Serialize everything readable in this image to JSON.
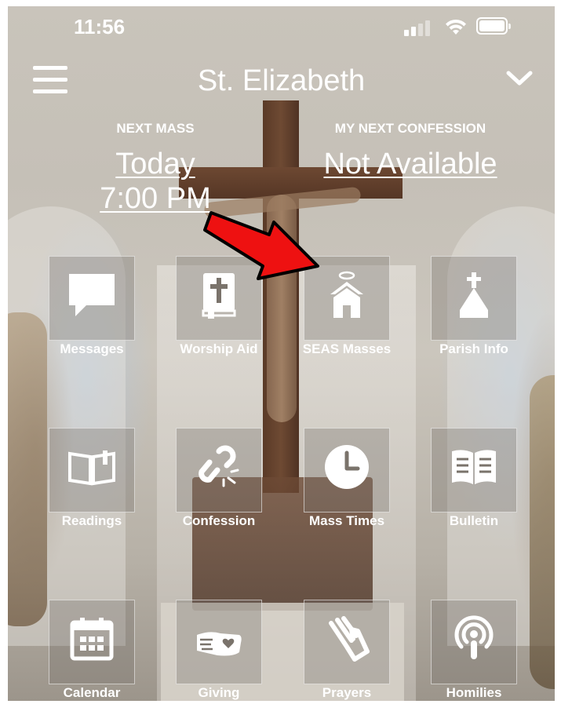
{
  "status_bar": {
    "time": "11:56"
  },
  "header": {
    "title": "St. Elizabeth"
  },
  "next_mass": {
    "label": "NEXT MASS",
    "day": "Today",
    "time": "7:00 PM"
  },
  "next_confession": {
    "label": "MY NEXT CONFESSION",
    "value": "Not Available"
  },
  "tiles": [
    {
      "label": "Messages",
      "icon": "message-icon"
    },
    {
      "label": "Worship Aid",
      "icon": "bible-icon"
    },
    {
      "label": "SEAS Masses",
      "icon": "church-icon"
    },
    {
      "label": "Parish Info",
      "icon": "steeple-icon"
    },
    {
      "label": "Readings",
      "icon": "open-book-icon"
    },
    {
      "label": "Confession",
      "icon": "broken-link-icon"
    },
    {
      "label": "Mass Times",
      "icon": "clock-icon"
    },
    {
      "label": "Bulletin",
      "icon": "bulletin-icon"
    },
    {
      "label": "Calendar",
      "icon": "calendar-icon"
    },
    {
      "label": "Giving",
      "icon": "giving-hand-icon"
    },
    {
      "label": "Prayers",
      "icon": "praying-hands-icon"
    },
    {
      "label": "Homilies",
      "icon": "podcast-icon"
    }
  ],
  "annotation": {
    "arrow_color": "#ee1111"
  }
}
